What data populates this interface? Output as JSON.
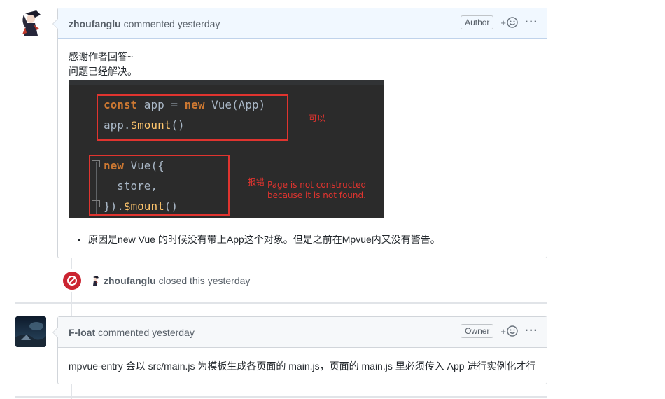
{
  "comments": [
    {
      "author": "zhoufanglu",
      "meta": "commented yesterday",
      "role": "Author",
      "reaction_plus": "+",
      "body_lines": [
        "感谢作者回答~",
        "问题已经解决。"
      ],
      "code": {
        "line1_kw1": "const",
        "line1_rest": " app = ",
        "line1_kw2": "new",
        "line1_end": " Vue(App)",
        "line2_start": "app.",
        "line2_fn": "$mount",
        "line2_end": "()",
        "line3_kw": "new",
        "line3_end": " Vue({",
        "line4": "  store,",
        "line5_start": "}).",
        "line5_fn": "$mount",
        "line5_end": "()",
        "label_ok": "可以",
        "label_err": "报错",
        "err_msg_1": "Page is not constructed",
        "err_msg_2": "because it is not found."
      },
      "bullet": "原因是new Vue 的时候没有带上App这个对象。但是之前在Mpvue内又没有警告。"
    },
    {
      "author": "F-loat",
      "meta": "commented yesterday",
      "role": "Owner",
      "reaction_plus": "+",
      "body": "mpvue-entry 会以 src/main.js 为模板生成各页面的 main.js，页面的 main.js 里必须传入 App 进行实例化才行"
    }
  ],
  "event": {
    "author": "zhoufanglu",
    "text": "closed this yesterday"
  },
  "colors": {
    "header_blue": "#f1f8ff",
    "closed_red": "#cb2431",
    "annotation_red": "#e0342f"
  },
  "icons": [
    "smiley-icon",
    "kebab-icon",
    "closed-icon"
  ]
}
